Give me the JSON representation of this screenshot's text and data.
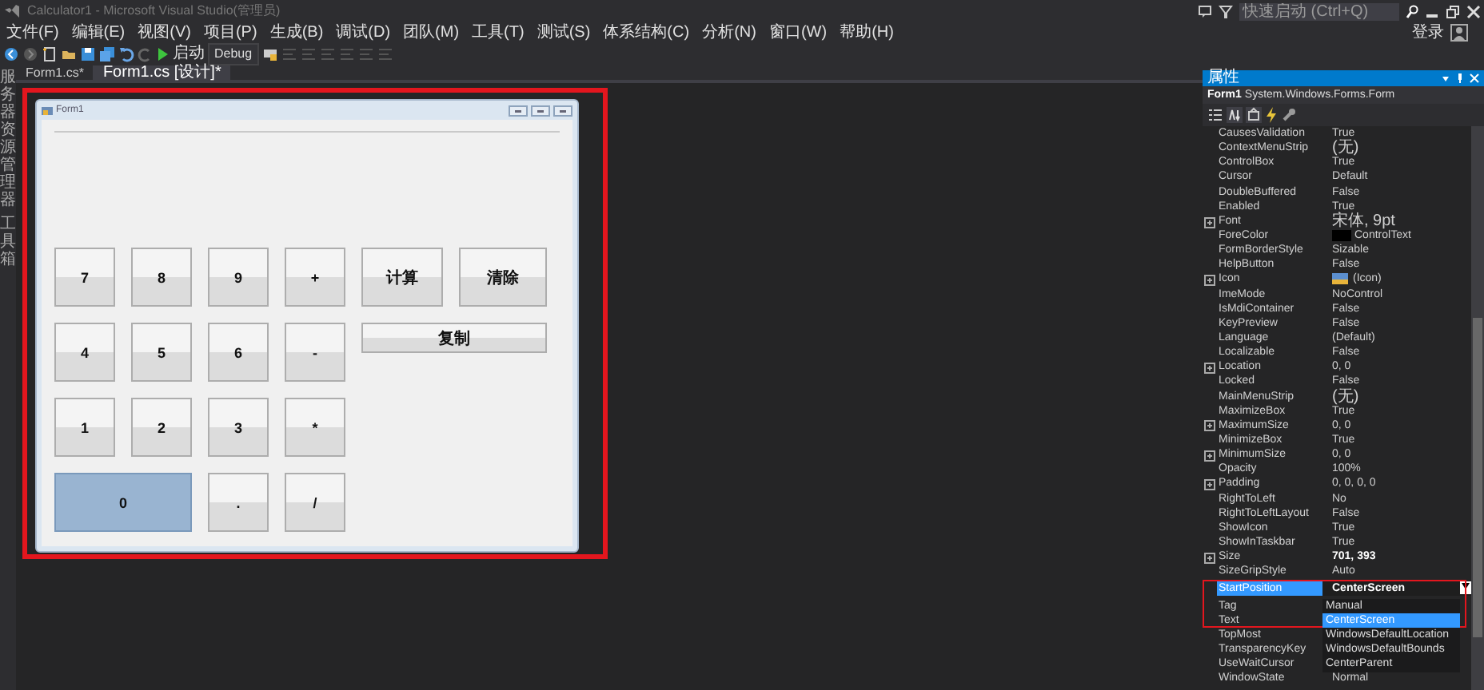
{
  "window": {
    "title": "Calculator1 - Microsoft Visual Studio(管理员)"
  },
  "title_bar": {
    "quick_launch": {
      "placeholder": "快速启动 (Ctrl+Q)"
    },
    "sign_in": "登录"
  },
  "menu": [
    "文件(F)",
    "编辑(E)",
    "视图(V)",
    "项目(P)",
    "生成(B)",
    "调试(D)",
    "团队(M)",
    "工具(T)",
    "测试(S)",
    "体系结构(C)",
    "分析(N)",
    "窗口(W)",
    "帮助(H)"
  ],
  "toolbar": {
    "start": "启动",
    "configuration": "Debug"
  },
  "side_strip": [
    "服务器资源管理器",
    "工具箱"
  ],
  "document_tabs": [
    {
      "label": "Form1.cs*",
      "selected": false
    },
    {
      "label": "Form1.cs [设计]*",
      "selected": true
    }
  ],
  "designer": {
    "form_title": "Form1",
    "button_rows": [
      [
        {
          "label": "7",
          "kind": "normal",
          "selected": false
        },
        {
          "label": "8",
          "kind": "normal",
          "selected": false
        },
        {
          "label": "9",
          "kind": "normal",
          "selected": false
        },
        {
          "label": "+",
          "kind": "normal",
          "selected": false
        },
        {
          "label": "计算",
          "kind": "large",
          "selected": false
        },
        {
          "label": "清除",
          "kind": "large",
          "selected": false
        }
      ],
      [
        {
          "label": "4",
          "kind": "normal",
          "selected": false
        },
        {
          "label": "5",
          "kind": "normal",
          "selected": false
        },
        {
          "label": "6",
          "kind": "normal",
          "selected": false
        },
        {
          "label": "-",
          "kind": "normal",
          "selected": false
        },
        {
          "label": "复制",
          "kind": "bar",
          "selected": false
        }
      ],
      [
        {
          "label": "1",
          "kind": "normal",
          "selected": false
        },
        {
          "label": "2",
          "kind": "normal",
          "selected": false
        },
        {
          "label": "3",
          "kind": "normal",
          "selected": false
        },
        {
          "label": "*",
          "kind": "normal",
          "selected": false
        }
      ],
      [
        {
          "label": "0",
          "kind": "wide",
          "selected": true
        },
        {
          "label": ".",
          "kind": "normal",
          "selected": false
        },
        {
          "label": "/",
          "kind": "normal",
          "selected": false
        }
      ]
    ]
  },
  "properties": {
    "title": "属性",
    "object": {
      "name": "Form1",
      "type": "System.Windows.Forms.Form"
    },
    "rows": [
      {
        "name": "CausesValidation",
        "value": "True",
        "expandable": false,
        "selected": false,
        "modified": false
      },
      {
        "name": "ContextMenuStrip",
        "value": "(无)",
        "expandable": false,
        "selected": false,
        "modified": false
      },
      {
        "name": "ControlBox",
        "value": "True",
        "expandable": false,
        "selected": false,
        "modified": false
      },
      {
        "name": "Cursor",
        "value": "Default",
        "expandable": false,
        "selected": false,
        "modified": false
      },
      {
        "name": "DoubleBuffered",
        "value": "False",
        "expandable": false,
        "selected": false,
        "modified": false
      },
      {
        "name": "Enabled",
        "value": "True",
        "expandable": false,
        "selected": false,
        "modified": false
      },
      {
        "name": "Font",
        "value": "宋体, 9pt",
        "expandable": true,
        "selected": false,
        "modified": false
      },
      {
        "name": "ForeColor",
        "value": "ControlText",
        "kind": "color",
        "color": "#000000",
        "expandable": false,
        "selected": false,
        "modified": false
      },
      {
        "name": "FormBorderStyle",
        "value": "Sizable",
        "expandable": false,
        "selected": false,
        "modified": false
      },
      {
        "name": "HelpButton",
        "value": "False",
        "expandable": false,
        "selected": false,
        "modified": false
      },
      {
        "name": "Icon",
        "value": "(Icon)",
        "kind": "icon",
        "expandable": true,
        "selected": false,
        "modified": false
      },
      {
        "name": "ImeMode",
        "value": "NoControl",
        "expandable": false,
        "selected": false,
        "modified": false
      },
      {
        "name": "IsMdiContainer",
        "value": "False",
        "expandable": false,
        "selected": false,
        "modified": false
      },
      {
        "name": "KeyPreview",
        "value": "False",
        "expandable": false,
        "selected": false,
        "modified": false
      },
      {
        "name": "Language",
        "value": "(Default)",
        "expandable": false,
        "selected": false,
        "modified": false
      },
      {
        "name": "Localizable",
        "value": "False",
        "expandable": false,
        "selected": false,
        "modified": false
      },
      {
        "name": "Location",
        "value": "0, 0",
        "expandable": true,
        "selected": false,
        "modified": false
      },
      {
        "name": "Locked",
        "value": "False",
        "expandable": false,
        "selected": false,
        "modified": false
      },
      {
        "name": "MainMenuStrip",
        "value": "(无)",
        "expandable": false,
        "selected": false,
        "modified": false
      },
      {
        "name": "MaximizeBox",
        "value": "True",
        "expandable": false,
        "selected": false,
        "modified": false
      },
      {
        "name": "MaximumSize",
        "value": "0, 0",
        "expandable": true,
        "selected": false,
        "modified": false
      },
      {
        "name": "MinimizeBox",
        "value": "True",
        "expandable": false,
        "selected": false,
        "modified": false
      },
      {
        "name": "MinimumSize",
        "value": "0, 0",
        "expandable": true,
        "selected": false,
        "modified": false
      },
      {
        "name": "Opacity",
        "value": "100%",
        "expandable": false,
        "selected": false,
        "modified": false
      },
      {
        "name": "Padding",
        "value": "0, 0, 0, 0",
        "expandable": true,
        "selected": false,
        "modified": false
      },
      {
        "name": "RightToLeft",
        "value": "No",
        "expandable": false,
        "selected": false,
        "modified": false
      },
      {
        "name": "RightToLeftLayout",
        "value": "False",
        "expandable": false,
        "selected": false,
        "modified": false
      },
      {
        "name": "ShowIcon",
        "value": "True",
        "expandable": false,
        "selected": false,
        "modified": false
      },
      {
        "name": "ShowInTaskbar",
        "value": "True",
        "expandable": false,
        "selected": false,
        "modified": false
      },
      {
        "name": "Size",
        "value": "701, 393",
        "expandable": true,
        "selected": false,
        "modified": true
      },
      {
        "name": "SizeGripStyle",
        "value": "Auto",
        "expandable": false,
        "selected": false,
        "modified": false
      },
      {
        "name": "StartPosition",
        "value": "CenterScreen",
        "expandable": false,
        "selected": true,
        "modified": false
      },
      {
        "name": "Tag",
        "expandable": false,
        "selected": false,
        "modified": false
      },
      {
        "name": "Text",
        "expandable": false,
        "selected": false,
        "modified": false
      },
      {
        "name": "TopMost",
        "expandable": false,
        "selected": false,
        "modified": false
      },
      {
        "name": "TransparencyKey",
        "expandable": false,
        "selected": false,
        "modified": false
      },
      {
        "name": "UseWaitCursor",
        "expandable": false,
        "selected": false,
        "modified": false
      },
      {
        "name": "WindowState",
        "value": "Normal",
        "expandable": false,
        "selected": false,
        "modified": false
      }
    ],
    "dropdown": {
      "options": [
        {
          "label": "Manual",
          "selected": false
        },
        {
          "label": "CenterScreen",
          "selected": true
        },
        {
          "label": "WindowsDefaultLocation",
          "selected": false
        },
        {
          "label": "WindowsDefaultBounds",
          "selected": false
        },
        {
          "label": "CenterParent",
          "selected": false
        }
      ]
    }
  }
}
